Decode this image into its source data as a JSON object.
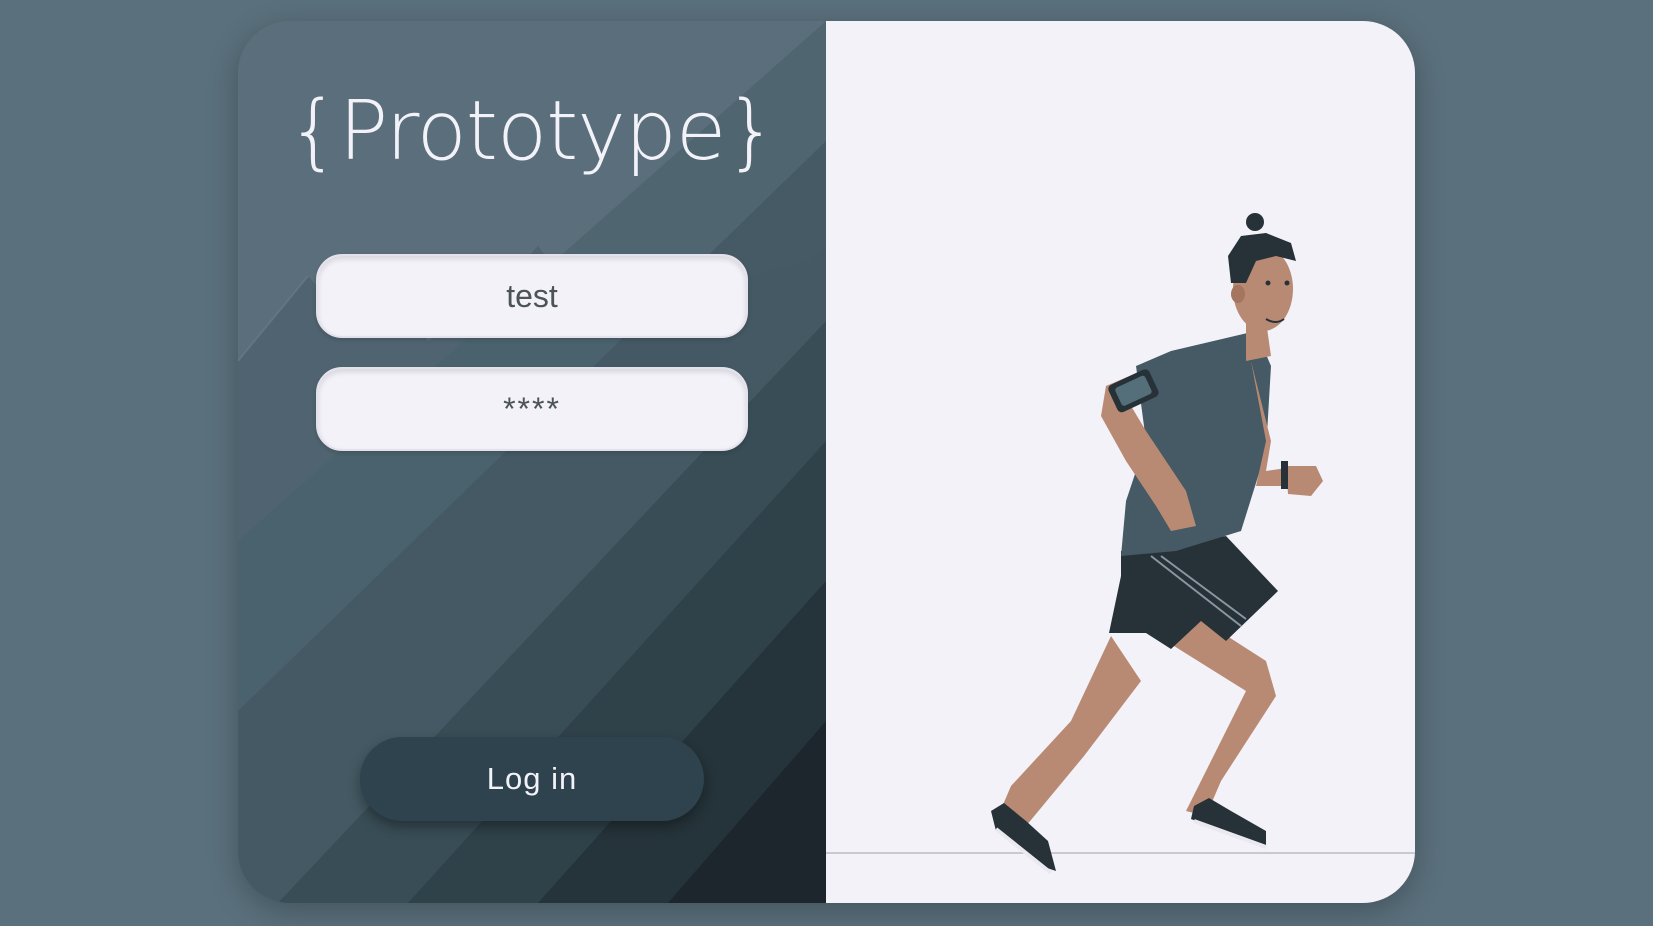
{
  "brand": {
    "logo_text": "{Prototype}"
  },
  "login_form": {
    "username_value": "test",
    "password_value": "****",
    "login_button_label": "Log in"
  },
  "colors": {
    "page_background": "#5a707c",
    "left_panel": "#5a6f7b",
    "right_panel": "#f3f2f9",
    "button": "#2e434d"
  },
  "illustration": {
    "subject": "runner-illustration"
  }
}
